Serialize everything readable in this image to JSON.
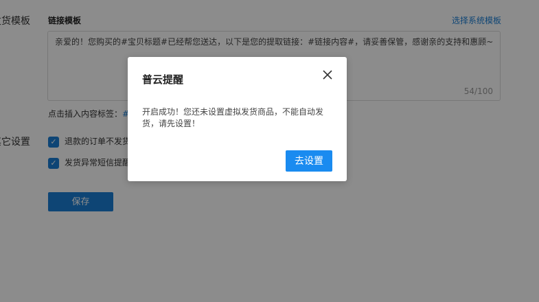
{
  "sections": {
    "delivery_template_label": "发货模板",
    "other_settings_label": "其它设置"
  },
  "template": {
    "title": "链接模板",
    "choose_link": "选择系统模板",
    "content": "亲爱的！您购买的#宝贝标题#已经帮您送达，以下是您的提取链接：#链接内容#，请妥善保管，感谢亲的支持和惠顾~",
    "char_count": "54/100"
  },
  "insert": {
    "prefix": "点击插入内容标签：",
    "tag": "#"
  },
  "options": [
    {
      "label": "退款的订单不发货",
      "checked": true
    },
    {
      "label": "发货异常短信提醒",
      "checked": true
    }
  ],
  "save_label": "保存",
  "modal": {
    "title": "普云提醒",
    "body": "开启成功！您还未设置虚拟发货商品，不能自动发货，请先设置！",
    "action": "去设置"
  },
  "colors": {
    "accent": "#1a7fd6",
    "modal_button": "#1a8bf0",
    "overlay": "rgba(0,0,0,0.45)"
  }
}
